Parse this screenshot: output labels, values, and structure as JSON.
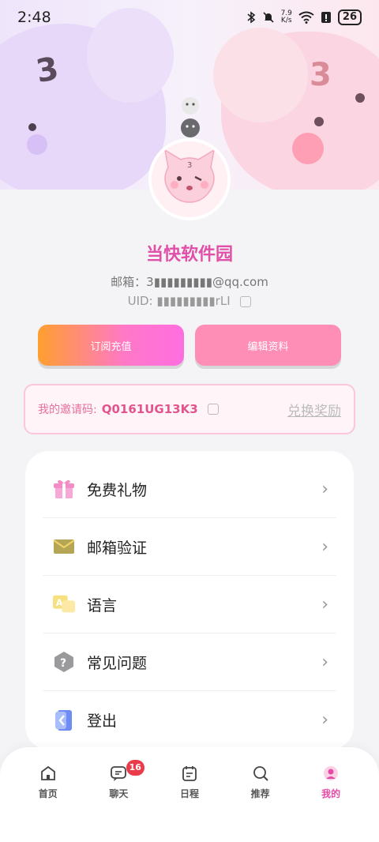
{
  "status": {
    "time": "2:48",
    "speed_value": "7.9",
    "speed_unit": "K/s",
    "battery": "26"
  },
  "profile": {
    "name": "当快软件园",
    "email_label": "邮箱：",
    "email_value": "3▮▮▮▮▮▮▮▮▮@qq.com",
    "uid_label": "UID: ",
    "uid_value": "▮▮▮▮▮▮▮▮▮rLI"
  },
  "actions": {
    "subscribe_label": "订阅充值",
    "edit_label": "编辑资料"
  },
  "invite": {
    "label": "我的邀请码:",
    "code": "Q0161UG13K3",
    "redeem_label": "兑换奖励"
  },
  "menu": {
    "items": [
      {
        "label": "免费礼物",
        "icon": "gift-icon"
      },
      {
        "label": "邮箱验证",
        "icon": "envelope-icon"
      },
      {
        "label": "语言",
        "icon": "translate-icon"
      },
      {
        "label": "常见问题",
        "icon": "question-icon"
      },
      {
        "label": "登出",
        "icon": "logout-icon"
      }
    ]
  },
  "tabs": [
    {
      "label": "首页",
      "icon": "home-icon"
    },
    {
      "label": "聊天",
      "icon": "chat-icon",
      "badge": "16"
    },
    {
      "label": "日程",
      "icon": "calendar-icon"
    },
    {
      "label": "推荐",
      "icon": "search-icon"
    },
    {
      "label": "我的",
      "icon": "profile-icon",
      "active": true
    }
  ],
  "colors": {
    "accent": "#e54aa6",
    "name": "#e04fa8",
    "invite_code": "#e2548c",
    "edit_button": "#ff8eb6",
    "badge": "#e93b4a"
  }
}
